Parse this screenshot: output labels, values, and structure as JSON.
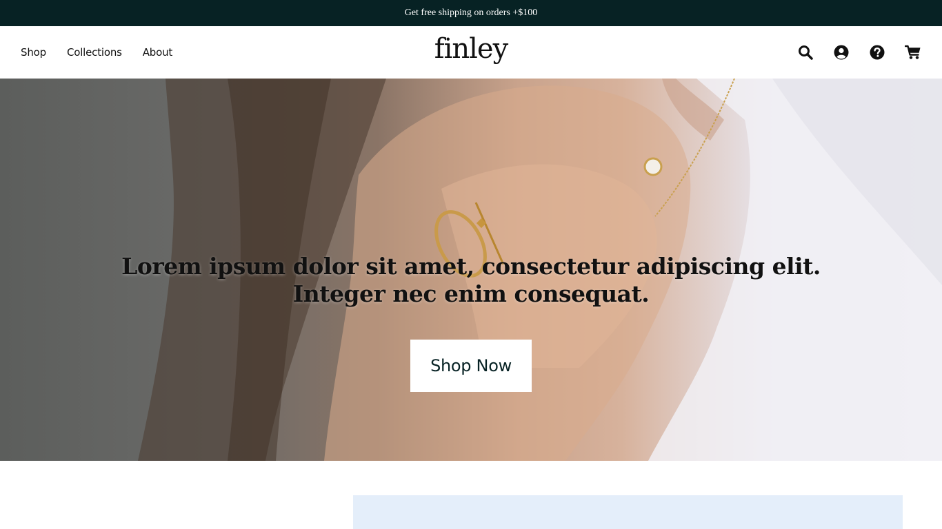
{
  "announcement": {
    "text": "Get free shipping on orders +$100"
  },
  "header": {
    "nav": [
      {
        "label": "Shop"
      },
      {
        "label": "Collections"
      },
      {
        "label": "About"
      }
    ],
    "logo": "finley",
    "icons": [
      "search-icon",
      "account-icon",
      "help-icon",
      "cart-icon"
    ]
  },
  "hero": {
    "headline": "Lorem ipsum dolor sit amet, consectetur adipiscing elit. Integer nec enim consequat.",
    "cta_label": "Shop Now"
  },
  "colors": {
    "announcement_bg": "#072224",
    "cta_text": "#072224",
    "promo_block_bg": "#e4eefa"
  }
}
